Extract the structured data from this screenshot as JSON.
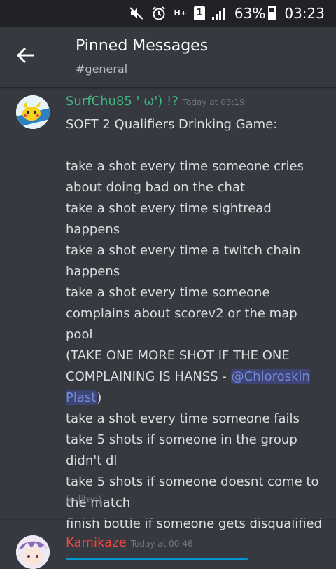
{
  "status_bar": {
    "battery": "63%",
    "time": "03:23",
    "sim": "1",
    "network": "H+"
  },
  "header": {
    "title": "Pinned Messages",
    "channel": "#general"
  },
  "messages": [
    {
      "author": "SurfChu85 ' ω') !?",
      "author_color": "#43b581",
      "timestamp": "Today at 03:19",
      "lines_before_mention": "SOFT 2 Qualifiers Drinking Game:\n\ntake a shot every time someone cries about doing bad on the chat\ntake a shot every time sightread happens\ntake a shot every time a twitch chain happens\ntake a shot every time someone complains about scorev2 or the map pool\n(TAKE ONE MORE SHOT IF THE ONE COMPLAINING IS HANSS - ",
      "mention": "@Chloroskin Plast",
      "lines_after_mention": ")\ntake a shot every time someone fails\ntake 5 shots if someone in the group didn't dl\ntake 5 shots if someone doesnt come to the match\nfinish bottle if someone gets disqualified",
      "edited_label": "(edited)"
    },
    {
      "author": "Kamikaze",
      "author_color": "#f04747",
      "timestamp": "Today at 00:46"
    }
  ],
  "colors": {
    "background": "#36393f",
    "statusbar": "#202225",
    "mention_bg": "#3e4474",
    "mention_fg": "#7289da"
  }
}
